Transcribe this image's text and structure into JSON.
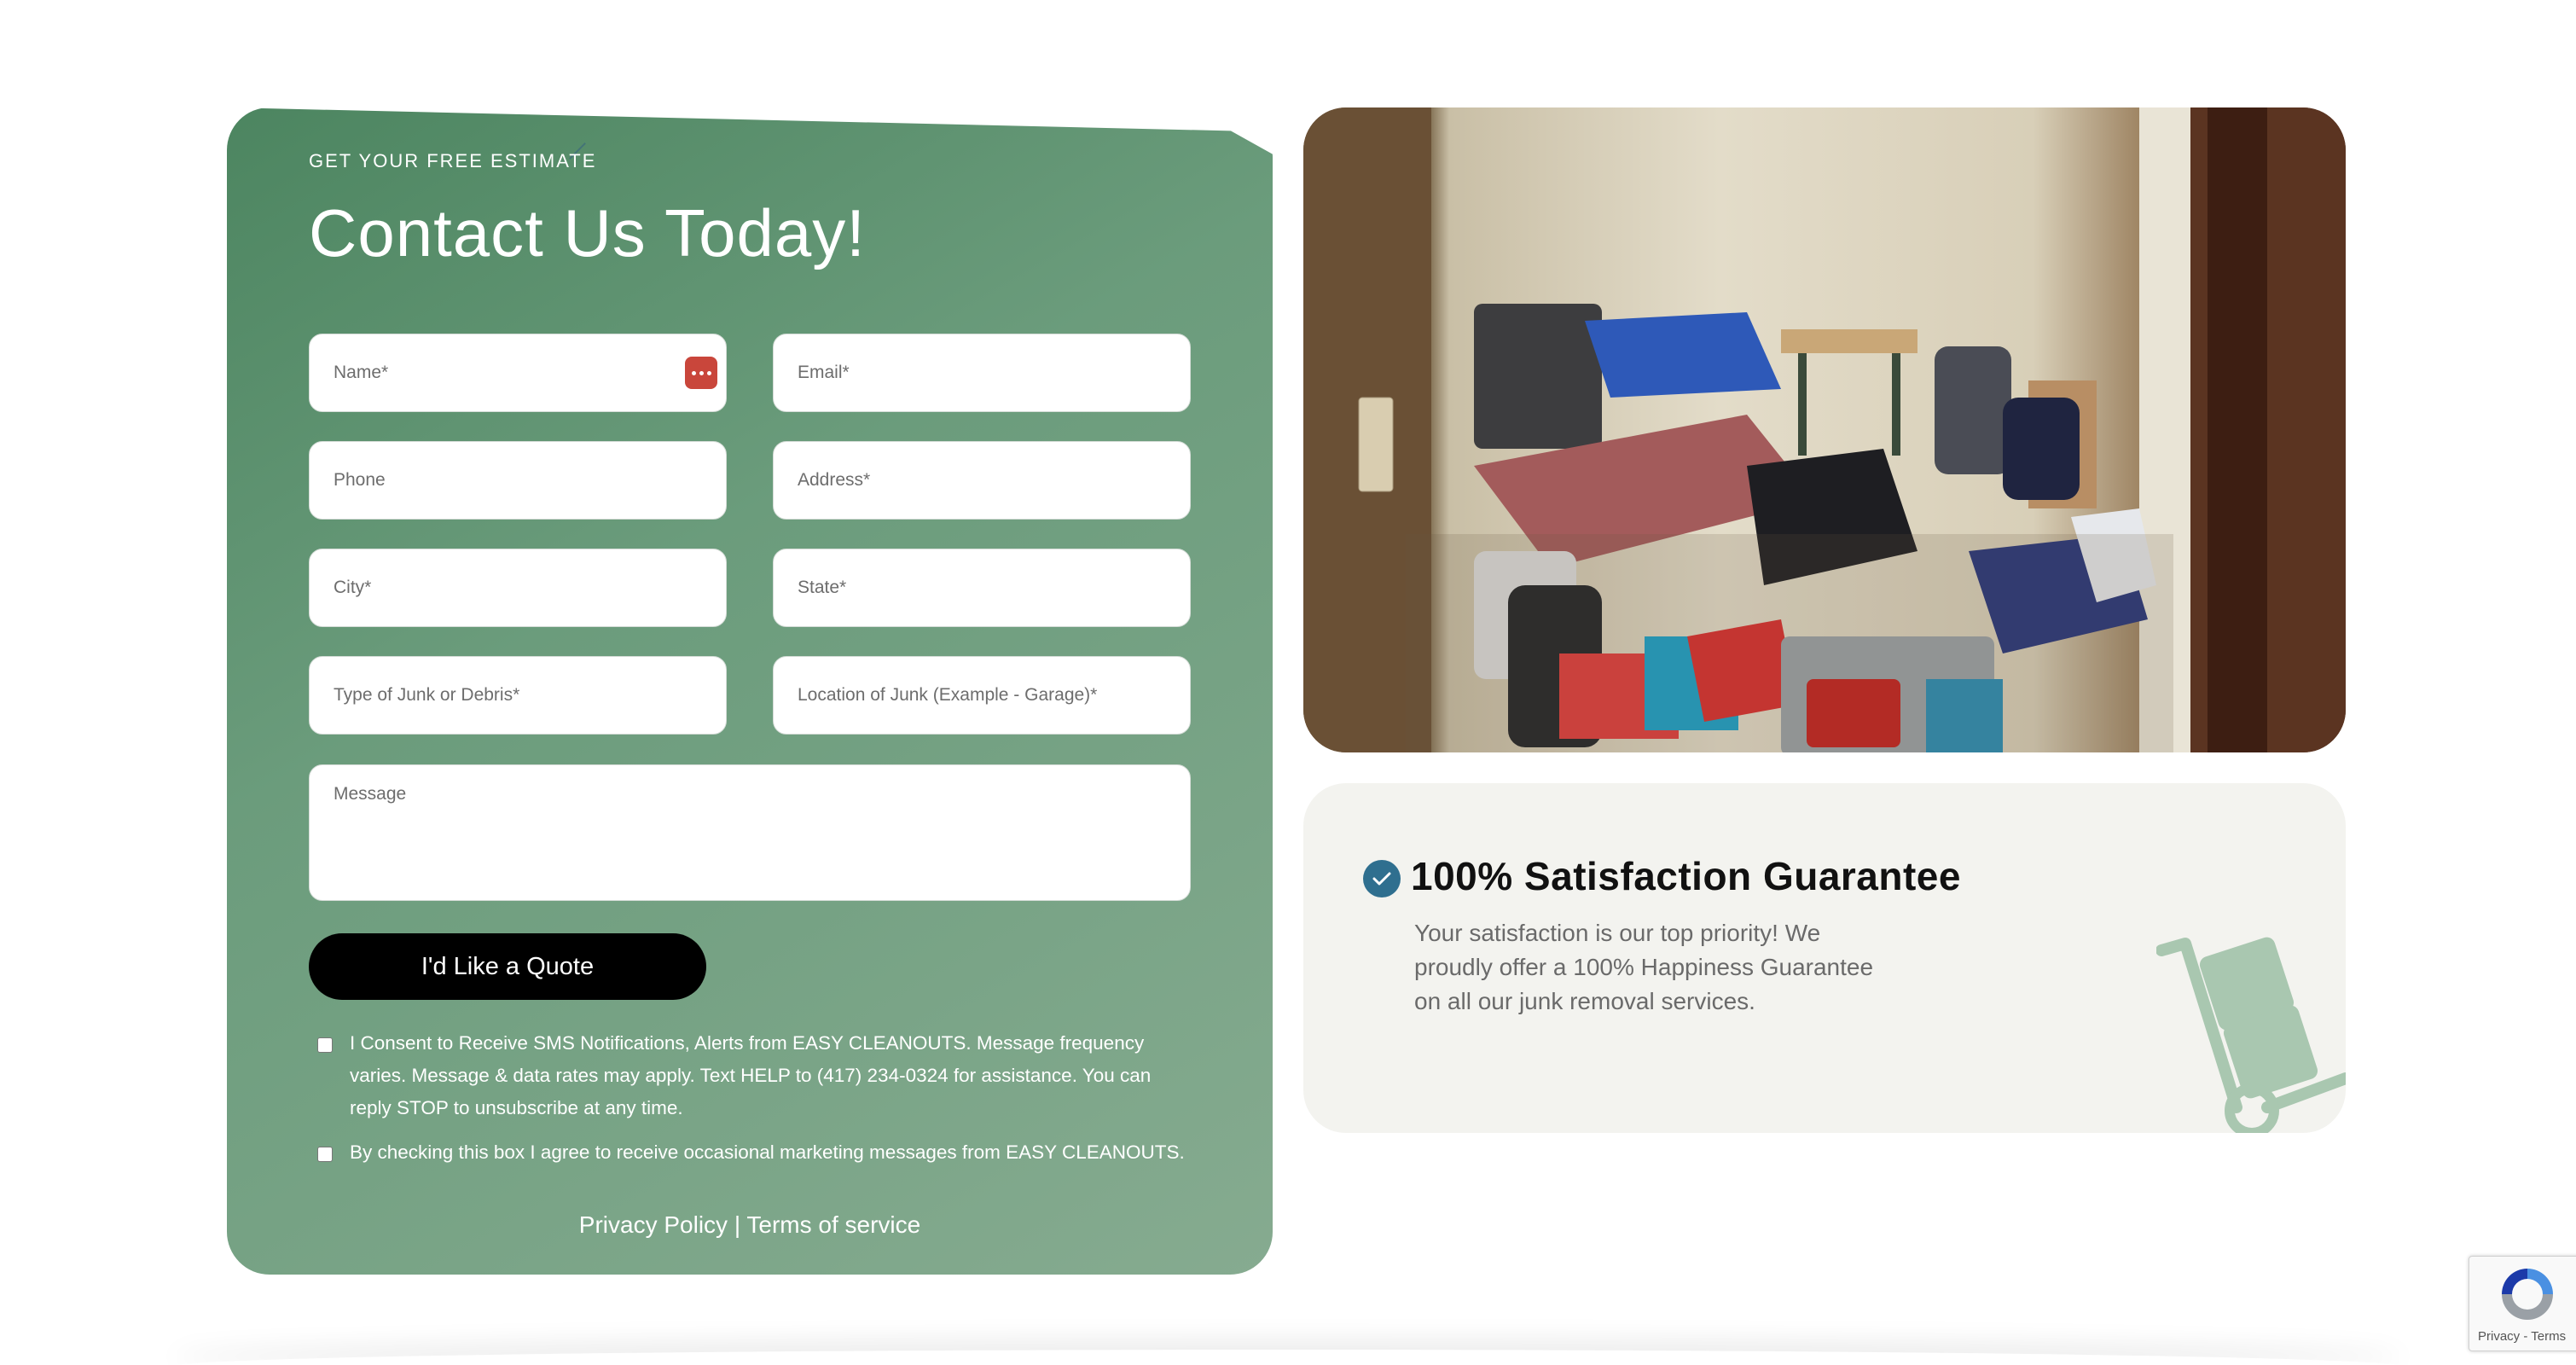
{
  "form": {
    "eyebrow": "GET YOUR FREE ESTIMATE",
    "title": "Contact Us Today!",
    "fields": {
      "name": "Name*",
      "email": "Email*",
      "phone": "Phone",
      "address": "Address*",
      "city": "City*",
      "state": "State*",
      "junk_type": "Type of Junk or Debris*",
      "junk_location": "Location of Junk (Example - Garage)*",
      "message": "Message"
    },
    "submit_label": "I'd Like a Quote",
    "consent_sms": "I Consent to Receive SMS Notifications, Alerts from EASY CLEANOUTS. Message frequency varies. Message & data rates may apply. Text HELP to (417) 234-0324 for assistance. You can reply STOP to unsubscribe at any time.",
    "consent_marketing": "By checking this box I agree to receive occasional marketing messages from EASY CLEANOUTS.",
    "privacy_link": "Privacy Policy",
    "separator": " | ",
    "terms_link": "Terms of service"
  },
  "guarantee": {
    "title": "100% Satisfaction Guarantee",
    "body": "Your satisfaction is our top priority! We proudly offer a 100% Happiness Guarantee on all our junk removal services."
  },
  "recaptcha": {
    "privacy": "Privacy",
    "separator": " - ",
    "terms": "Terms"
  },
  "colors": {
    "card_green": "#5e9070",
    "button": "#000000",
    "check_badge": "#2f6f8f",
    "dolly": "#a9c7b0"
  }
}
